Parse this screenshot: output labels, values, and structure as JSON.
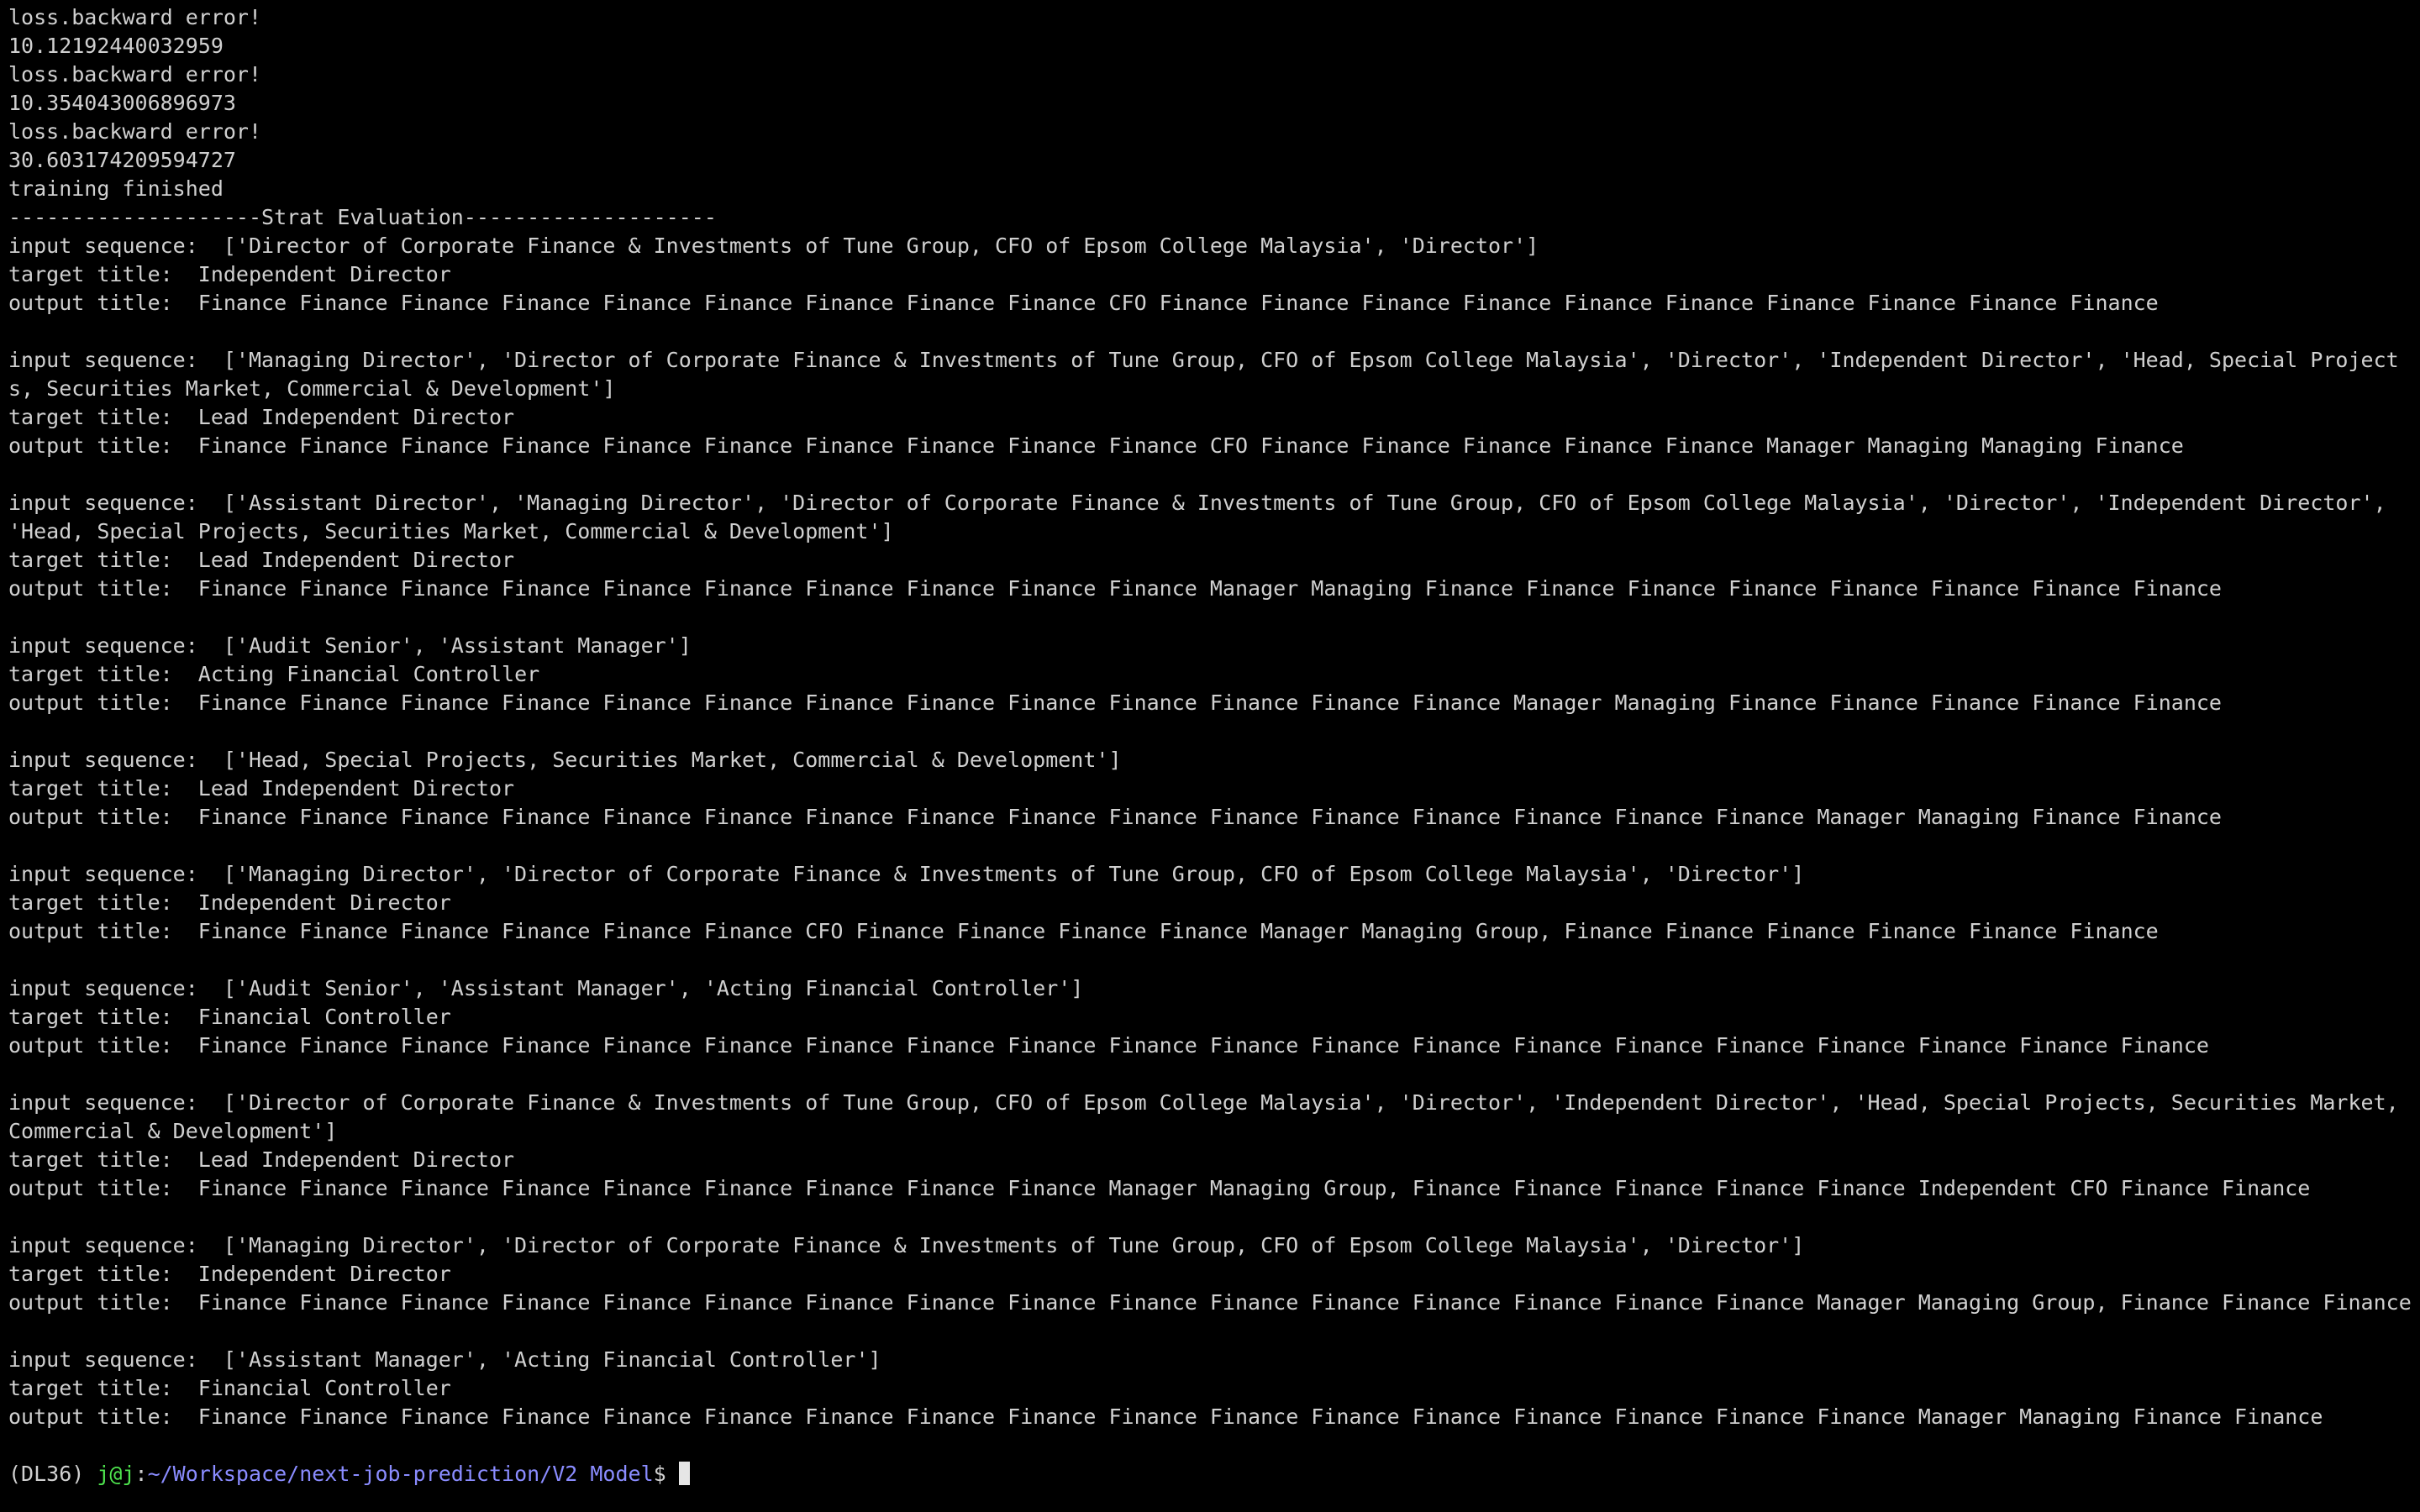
{
  "log_lines": [
    "loss.backward error!",
    "10.12192440032959",
    "loss.backward error!",
    "10.354043006896973",
    "loss.backward error!",
    "30.603174209594727",
    "training finished",
    "--------------------Strat Evaluation--------------------"
  ],
  "labels": {
    "input": "input sequence:  ",
    "target": "target title:  ",
    "output": "output title:  "
  },
  "records": [
    {
      "input": "['Director of Corporate Finance & Investments of Tune Group, CFO of Epsom College Malaysia', 'Director']",
      "target": "Independent Director",
      "output": "Finance Finance Finance Finance Finance Finance Finance Finance Finance CFO Finance Finance Finance Finance Finance Finance Finance Finance Finance Finance"
    },
    {
      "input": "['Managing Director', 'Director of Corporate Finance & Investments of Tune Group, CFO of Epsom College Malaysia', 'Director', 'Independent Director', 'Head, Special Projects, Securities Market, Commercial & Development']",
      "target": "Lead Independent Director",
      "output": "Finance Finance Finance Finance Finance Finance Finance Finance Finance Finance CFO Finance Finance Finance Finance Finance Manager Managing Managing Finance"
    },
    {
      "input": "['Assistant Director', 'Managing Director', 'Director of Corporate Finance & Investments of Tune Group, CFO of Epsom College Malaysia', 'Director', 'Independent Director', 'Head, Special Projects, Securities Market, Commercial & Development']",
      "target": "Lead Independent Director",
      "output": "Finance Finance Finance Finance Finance Finance Finance Finance Finance Finance Manager Managing Finance Finance Finance Finance Finance Finance Finance Finance"
    },
    {
      "input": "['Audit Senior', 'Assistant Manager']",
      "target": "Acting Financial Controller",
      "output": "Finance Finance Finance Finance Finance Finance Finance Finance Finance Finance Finance Finance Finance Manager Managing Finance Finance Finance Finance Finance"
    },
    {
      "input": "['Head, Special Projects, Securities Market, Commercial & Development']",
      "target": "Lead Independent Director",
      "output": "Finance Finance Finance Finance Finance Finance Finance Finance Finance Finance Finance Finance Finance Finance Finance Finance Manager Managing Finance Finance"
    },
    {
      "input": "['Managing Director', 'Director of Corporate Finance & Investments of Tune Group, CFO of Epsom College Malaysia', 'Director']",
      "target": "Independent Director",
      "output": "Finance Finance Finance Finance Finance Finance CFO Finance Finance Finance Finance Manager Managing Group, Finance Finance Finance Finance Finance Finance"
    },
    {
      "input": "['Audit Senior', 'Assistant Manager', 'Acting Financial Controller']",
      "target": "Financial Controller",
      "output": "Finance Finance Finance Finance Finance Finance Finance Finance Finance Finance Finance Finance Finance Finance Finance Finance Finance Finance Finance Finance"
    },
    {
      "input": "['Director of Corporate Finance & Investments of Tune Group, CFO of Epsom College Malaysia', 'Director', 'Independent Director', 'Head, Special Projects, Securities Market, Commercial & Development']",
      "target": "Lead Independent Director",
      "output": "Finance Finance Finance Finance Finance Finance Finance Finance Finance Manager Managing Group, Finance Finance Finance Finance Finance Independent CFO Finance Finance"
    },
    {
      "input": "['Managing Director', 'Director of Corporate Finance & Investments of Tune Group, CFO of Epsom College Malaysia', 'Director']",
      "target": "Independent Director",
      "output": "Finance Finance Finance Finance Finance Finance Finance Finance Finance Finance Finance Finance Finance Finance Finance Finance Manager Managing Group, Finance Finance Finance"
    },
    {
      "input": "['Assistant Manager', 'Acting Financial Controller']",
      "target": "Financial Controller",
      "output": "Finance Finance Finance Finance Finance Finance Finance Finance Finance Finance Finance Finance Finance Finance Finance Finance Finance Manager Managing Finance Finance"
    }
  ],
  "prompt": {
    "env": "(DL36) ",
    "user_host": "j@j",
    "separator": ":",
    "path": "~/Workspace/next-job-prediction/V2 Model",
    "symbol": "$ "
  },
  "colors": {
    "background": "#000000",
    "text": "#d0d0d0",
    "user_host": "#4ee44e",
    "path": "#8a8cff"
  }
}
